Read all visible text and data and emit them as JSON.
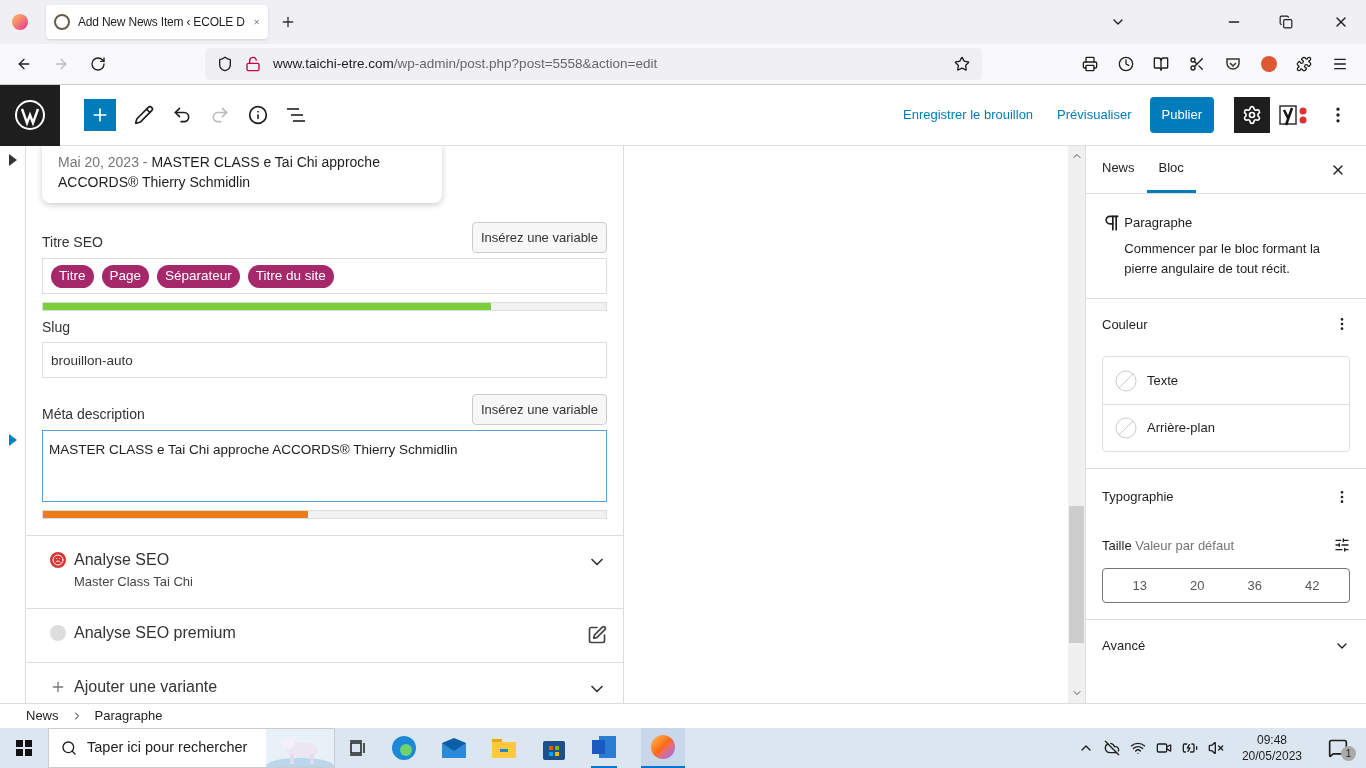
{
  "browser": {
    "tab_title": "Add New News Item ‹ ECOLE D",
    "url_host": "www.taichi-etre.com",
    "url_path": "/wp-admin/post.php?post=5558&action=edit"
  },
  "toolbar": {
    "save_draft": "Enregistrer le brouillon",
    "preview": "Prévisualiser",
    "publish": "Publier"
  },
  "seo": {
    "snippet_date": "Mai 20, 2023",
    "snippet_separator": "-",
    "snippet_title": "MASTER CLASS e Tai Chi approche ACCORDS® Thierry Schmidlin",
    "title_label": "Titre SEO",
    "title_insert": "Insérez une variable",
    "title_tags": [
      "Titre",
      "Page",
      "Séparateur",
      "Titre du site"
    ],
    "title_bar": {
      "level": 0.795,
      "color": "#7ad03a"
    },
    "slug_label": "Slug",
    "slug_value": "brouillon-auto",
    "meta_label": "Méta description",
    "meta_insert": "Insérez une variable",
    "meta_value": "MASTER CLASS e Tai Chi approche ACCORDS® Thierry Schmidlin",
    "meta_bar": {
      "level": 0.47,
      "color": "#ee7c1b"
    }
  },
  "sections": [
    {
      "kind": "analysis",
      "title": "Analyse SEO",
      "subtitle": "Master Class Tai Chi",
      "color": "#dc3232"
    },
    {
      "kind": "premium",
      "title": "Analyse SEO premium",
      "color": "#dddddd"
    },
    {
      "kind": "add",
      "title": "Ajouter une variante"
    }
  ],
  "sidebar": {
    "tabs": [
      {
        "label": "News",
        "selected": false
      },
      {
        "label": "Bloc",
        "selected": true
      }
    ],
    "block_name": "Paragraphe",
    "block_description": "Commencer par le bloc formant la pierre angulaire de tout récit.",
    "color_title": "Couleur",
    "color_items": [
      "Texte",
      "Arrière-plan"
    ],
    "typography_title": "Typographie",
    "size_label": "Taille",
    "size_value": "Valeur par défaut",
    "sizes": [
      "13",
      "20",
      "36",
      "42"
    ],
    "advanced": "Avancé"
  },
  "breadcrumb": [
    "News",
    "Paragraphe"
  ],
  "taskbar": {
    "search_placeholder": "Taper ici pour rechercher",
    "time": "09:48",
    "date": "20/05/2023",
    "notifications": "1"
  }
}
